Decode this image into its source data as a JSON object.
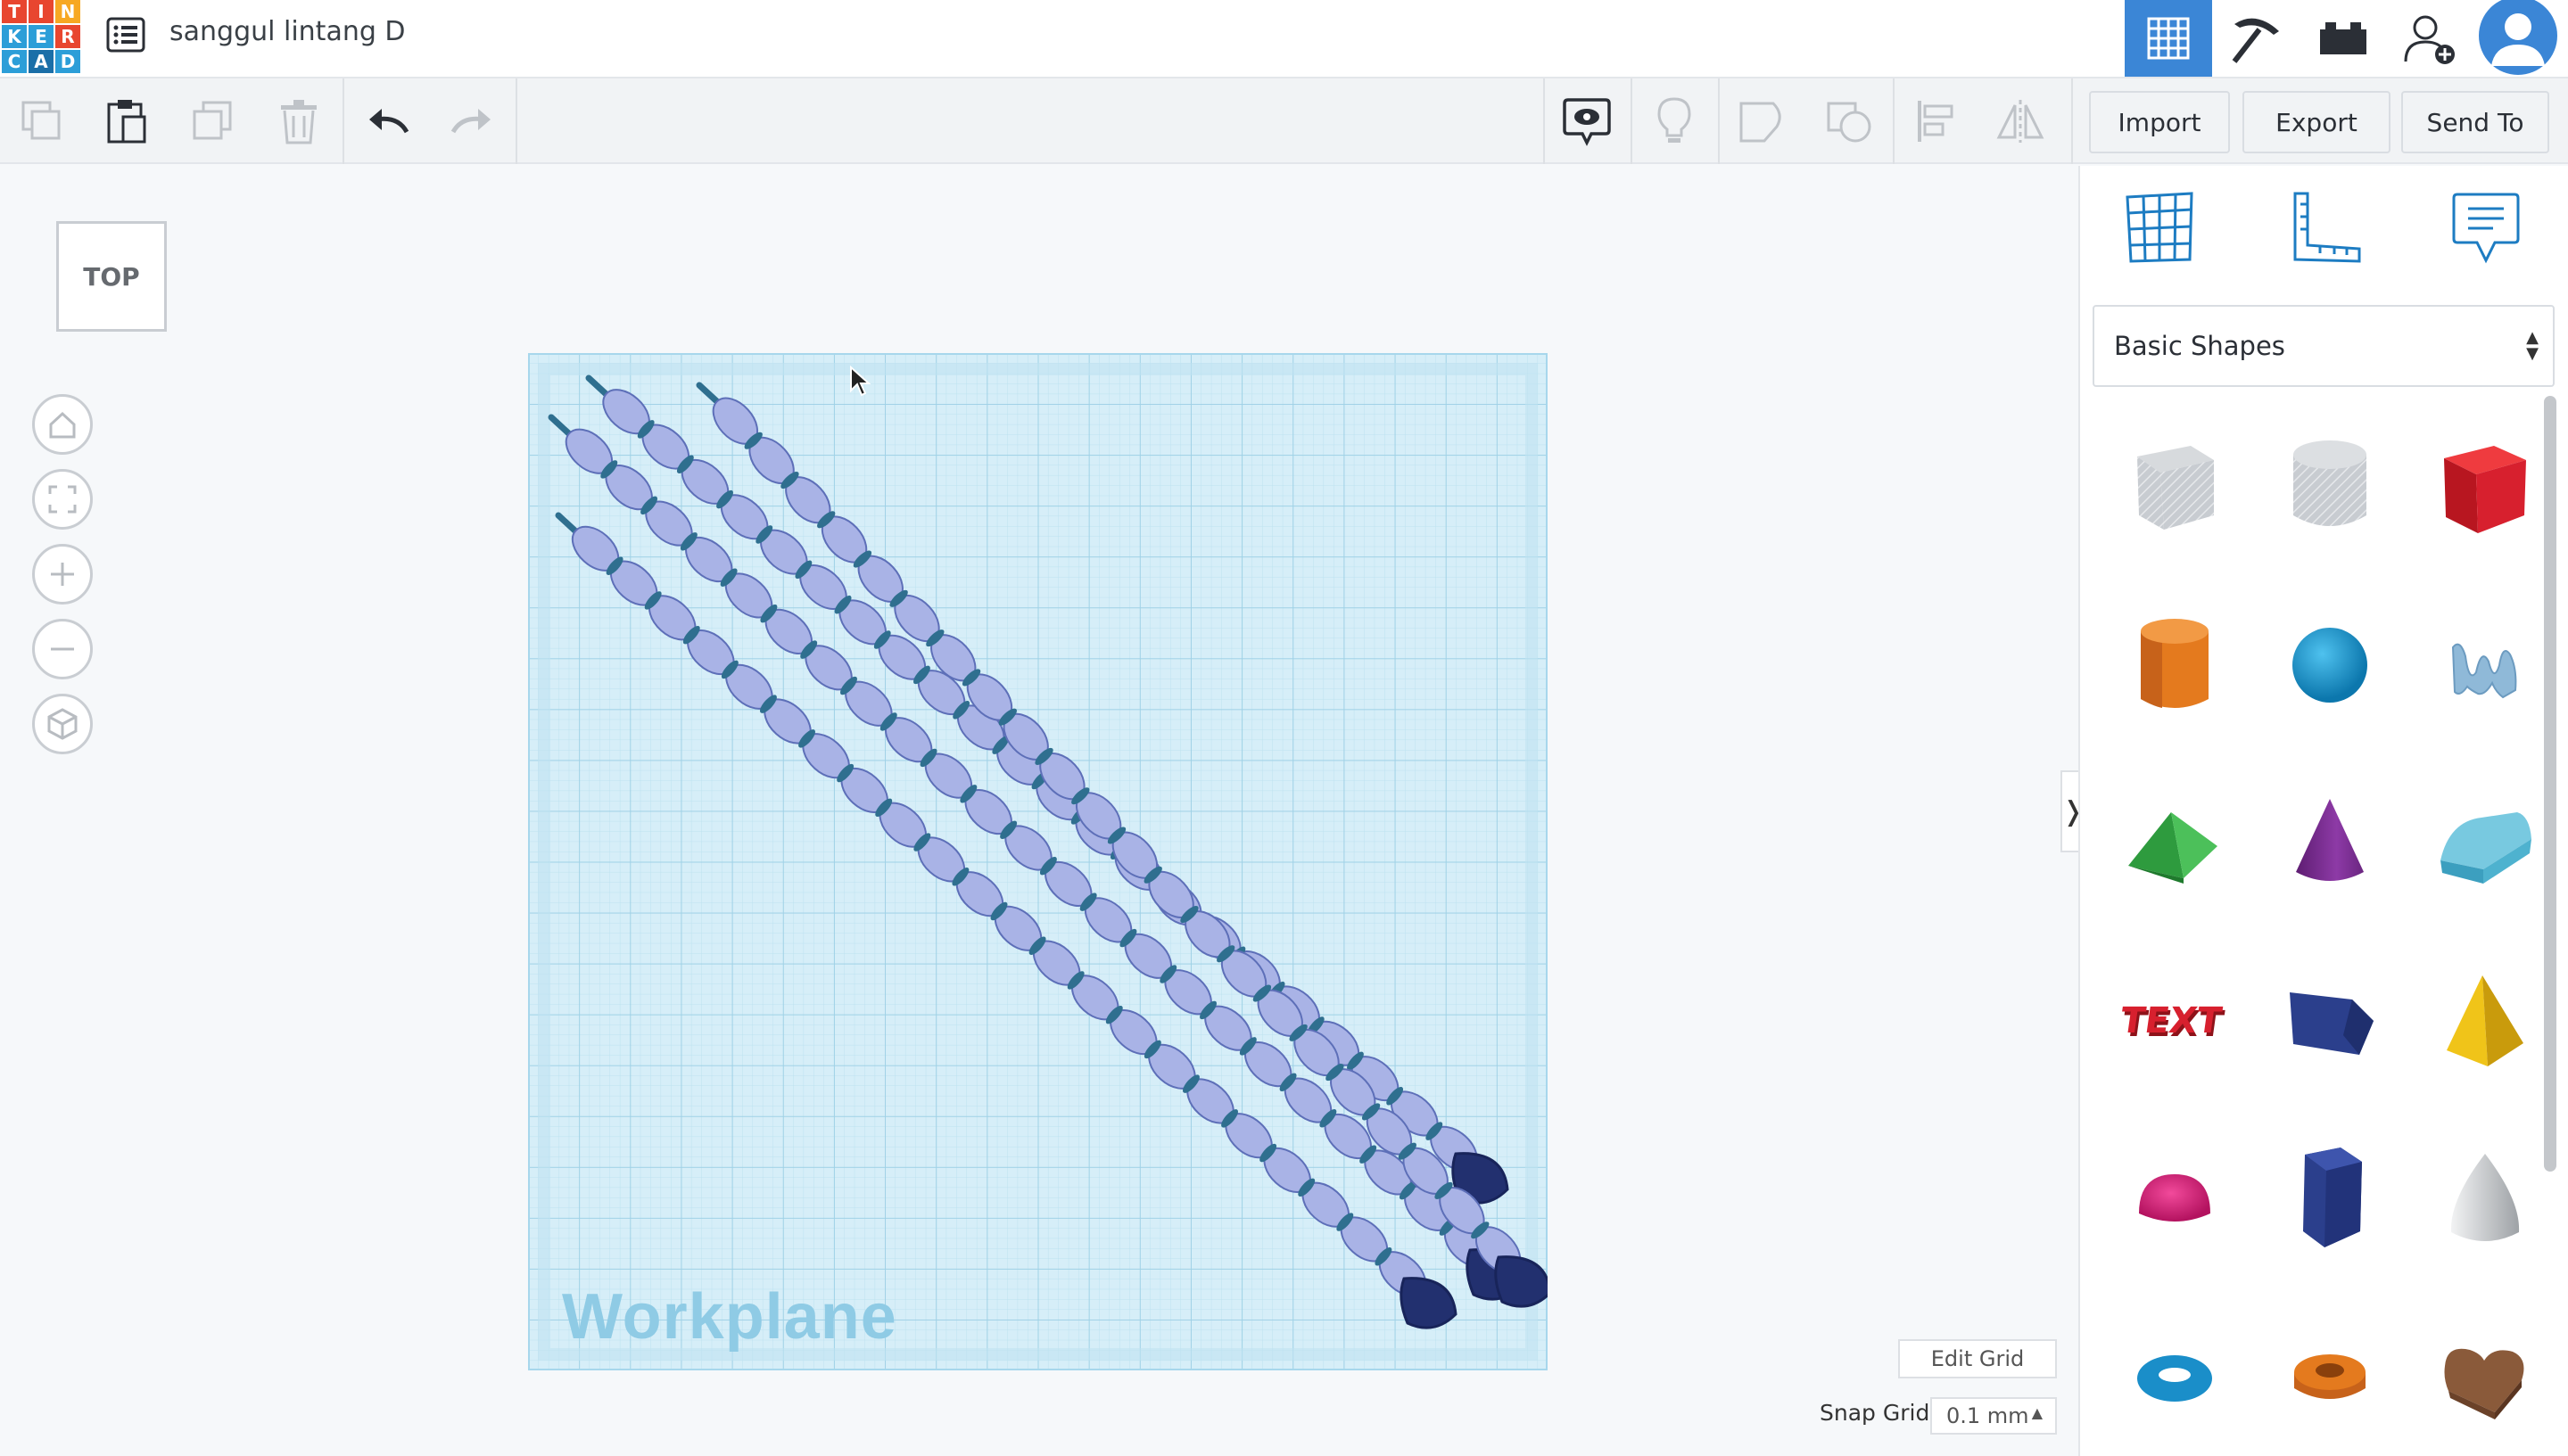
{
  "app": {
    "logo_letters": [
      "T",
      "I",
      "N",
      "K",
      "E",
      "R",
      "C",
      "A",
      "D"
    ],
    "logo_colors": [
      "#e8462f",
      "#e8462f",
      "#f7a823",
      "#2c9ed8",
      "#2c9ed8",
      "#e8462f",
      "#2c9ed8",
      "#1b6fa8",
      "#2c9ed8"
    ],
    "design_title": "sanggul lintang D"
  },
  "header_icons": [
    "3d-view-icon",
    "pickaxe-icon",
    "bricks-icon",
    "add-user-icon",
    "profile-avatar-icon"
  ],
  "toolbar": {
    "import_label": "Import",
    "export_label": "Export",
    "send_to_label": "Send To"
  },
  "viewcube": {
    "face_label": "TOP"
  },
  "workplane": {
    "label": "Workplane",
    "edit_grid_label": "Edit Grid",
    "snap_grid_label": "Snap Grid",
    "snap_grid_value": "0.1 mm"
  },
  "library": {
    "selected": "Basic Shapes",
    "shapes": [
      {
        "name": "box-hole",
        "color": "#b9bec4"
      },
      {
        "name": "cylinder-hole",
        "color": "#c3c7cb"
      },
      {
        "name": "box",
        "color": "#d7202e"
      },
      {
        "name": "cylinder",
        "color": "#e47a1e"
      },
      {
        "name": "sphere",
        "color": "#1797d1"
      },
      {
        "name": "scribble",
        "color": "#8fb9d8"
      },
      {
        "name": "roof",
        "color": "#2e9b3e"
      },
      {
        "name": "cone",
        "color": "#7a2c8f"
      },
      {
        "name": "round-roof",
        "color": "#5fb9d3"
      },
      {
        "name": "text",
        "color": "#c8202a"
      },
      {
        "name": "wedge",
        "color": "#2b3f8c"
      },
      {
        "name": "pyramid",
        "color": "#f0c419"
      },
      {
        "name": "half-sphere",
        "color": "#de1f7a"
      },
      {
        "name": "polygon",
        "color": "#2b3f8c"
      },
      {
        "name": "paraboloid",
        "color": "#c9cbcf"
      },
      {
        "name": "torus",
        "color": "#1a8ec9"
      },
      {
        "name": "tube",
        "color": "#e47a1e"
      },
      {
        "name": "heart",
        "color": "#8a5a3a"
      }
    ],
    "text_shape_label": "TEXT"
  }
}
